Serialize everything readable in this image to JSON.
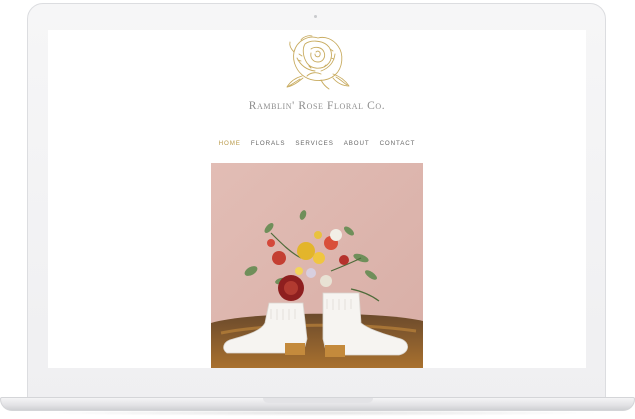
{
  "site": {
    "brand_name": "Ramblin' Rose Floral Co."
  },
  "nav": {
    "items": [
      {
        "label": "HOME",
        "active": true
      },
      {
        "label": "FLORALS",
        "active": false
      },
      {
        "label": "SERVICES",
        "active": false
      },
      {
        "label": "ABOUT",
        "active": false
      },
      {
        "label": "CONTACT",
        "active": false
      }
    ]
  },
  "colors": {
    "accent_gold": "#b99a4a",
    "nav_text": "#666666",
    "brand_text": "#8d8d8d",
    "photo_wall": "#dcb4ad"
  },
  "icons": {
    "logo": "rose-logo-icon"
  }
}
